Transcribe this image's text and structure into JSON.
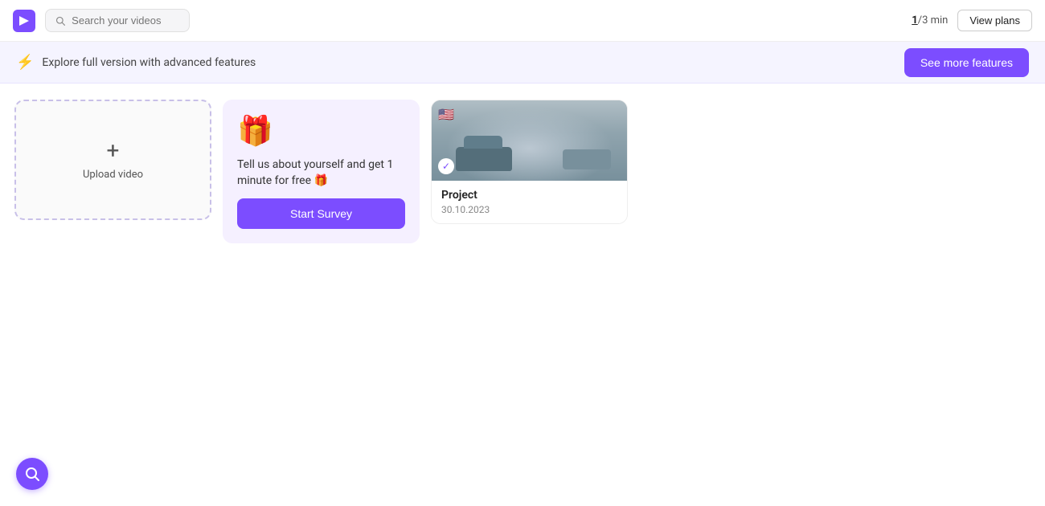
{
  "header": {
    "logo_alt": "Klapty logo",
    "search_placeholder": "Search your videos",
    "usage_current": "1",
    "usage_separator": "/",
    "usage_total": "3",
    "usage_unit": " min",
    "view_plans_label": "View plans"
  },
  "banner": {
    "icon": "⚡",
    "text": "Explore full version with advanced features",
    "see_more_label": "See more features"
  },
  "upload_card": {
    "plus": "+",
    "label": "Upload video"
  },
  "survey_card": {
    "gift_icon": "🎁",
    "text": "Tell us about yourself and get 1 minute for free 🎁",
    "button_label": "Start Survey"
  },
  "video_card": {
    "flag": "🇺🇸",
    "check": "✓",
    "title": "Project",
    "date": "30.10.2023"
  },
  "chat_button": {
    "icon": "🔍"
  }
}
